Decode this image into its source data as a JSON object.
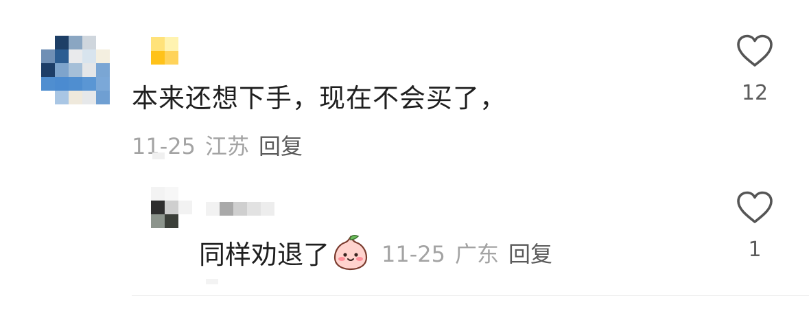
{
  "comment": {
    "text": "本来还想下手，现在不会买了，",
    "date": "11-25",
    "location": "江苏",
    "reply_label": "回复",
    "like_count": "12"
  },
  "reply": {
    "text": "同样劝退了",
    "date": "11-25",
    "location": "广东",
    "reply_label": "回复",
    "like_count": "1",
    "emoji_icon": "peach-face-emoji"
  },
  "icons": {
    "like": "heart-outline-icon"
  },
  "colors": {
    "text": "#1f1f1f",
    "meta": "#a3a3a3",
    "reply_link": "#5a5a5a",
    "icon": "#555555"
  }
}
